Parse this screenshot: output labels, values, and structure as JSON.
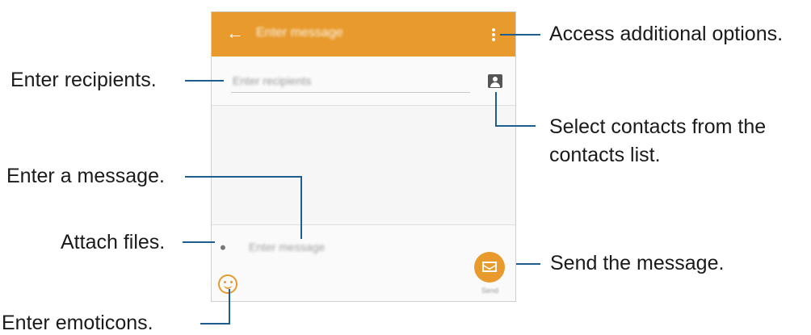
{
  "callouts": {
    "options": "Access additional options.",
    "recipients": "Enter recipients.",
    "contacts_line1": "Select contacts from the",
    "contacts_line2": "contacts list.",
    "message": "Enter a message.",
    "attach": "Attach files.",
    "send": "Send the message.",
    "emoticons": "Enter emoticons."
  },
  "screen": {
    "title": "Enter message",
    "recipients_placeholder": "Enter recipients",
    "message_placeholder": "Enter message",
    "send_label": "Send"
  },
  "colors": {
    "accent": "#e89a2c",
    "callout_line": "#1e5e8e"
  },
  "icons": [
    "back-arrow-icon",
    "more-options-icon",
    "contact-icon",
    "paperclip-icon",
    "emoticon-icon",
    "envelope-icon"
  ]
}
